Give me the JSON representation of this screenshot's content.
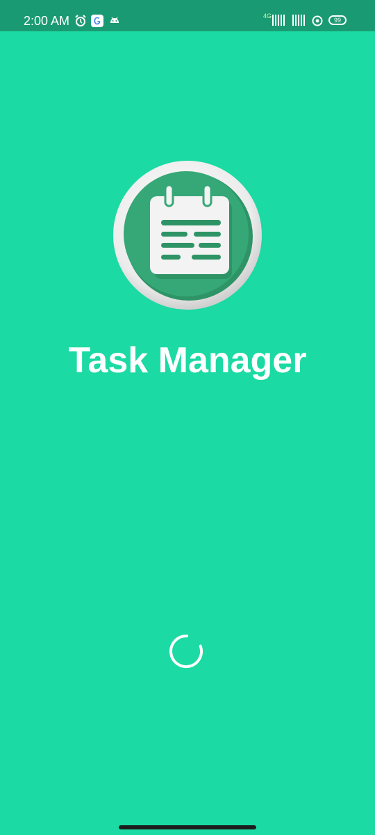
{
  "status_bar": {
    "time": "2:00 AM",
    "network_label": "4G",
    "battery_level": "99",
    "icons": [
      "alarm-icon",
      "google-icon",
      "android-icon",
      "signal-icon",
      "signal-icon",
      "hotspot-icon",
      "battery-icon"
    ]
  },
  "splash": {
    "app_name": "Task Manager",
    "logo_icon": "calendar-notes-icon",
    "loading_indicator": "spinner"
  },
  "colors": {
    "background": "#1bdaa3",
    "status_bar": "#1a9a72",
    "logo_green": "#36a877",
    "text": "#ffffff"
  }
}
